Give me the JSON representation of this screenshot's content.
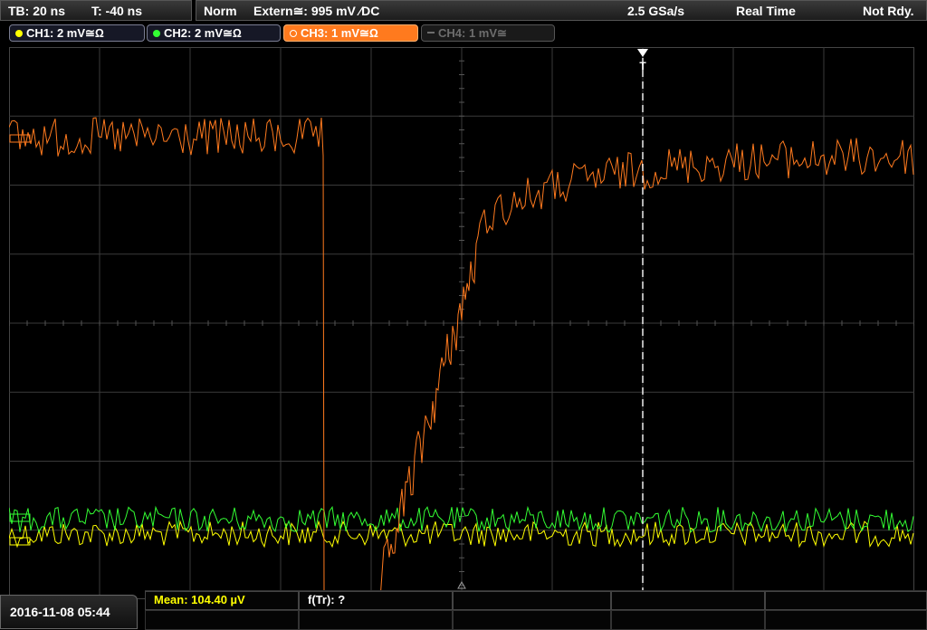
{
  "timebase": {
    "tb": "TB: 20 ns",
    "trigger_time": "T: -40 ns"
  },
  "acquisition": {
    "mode": "Norm",
    "trigger_source": "Extern≅: 995 mV ∕DC",
    "sample_rate": "2.5 GSa/s",
    "acq_type": "Real Time",
    "status": "Not Rdy."
  },
  "channels": [
    {
      "label": "CH1: 2 mV≅Ω",
      "color": "#ffff00",
      "state": "on"
    },
    {
      "label": "CH2: 2 mV≅Ω",
      "color": "#33ff33",
      "state": "on"
    },
    {
      "label": "CH3: 1 mV≅Ω",
      "color": "#ff7a1e",
      "state": "active"
    },
    {
      "label": "CH4: 1 mV≅",
      "color": "#6d6d6d",
      "state": "off"
    }
  ],
  "trigger_marker": "T",
  "datetime": "2016-11-08 05:44",
  "measurements": {
    "mean": "Mean: 104.40 µV",
    "ftr": "f(Tr): ?"
  },
  "colors": {
    "ch1": "#ffff00",
    "ch2": "#33ff33",
    "ch3": "#ff7a1e",
    "grid": "#3a3a3a",
    "background": "#000000"
  },
  "icons": [
    "trigger-position-icon",
    "channel-dot-icon"
  ]
}
